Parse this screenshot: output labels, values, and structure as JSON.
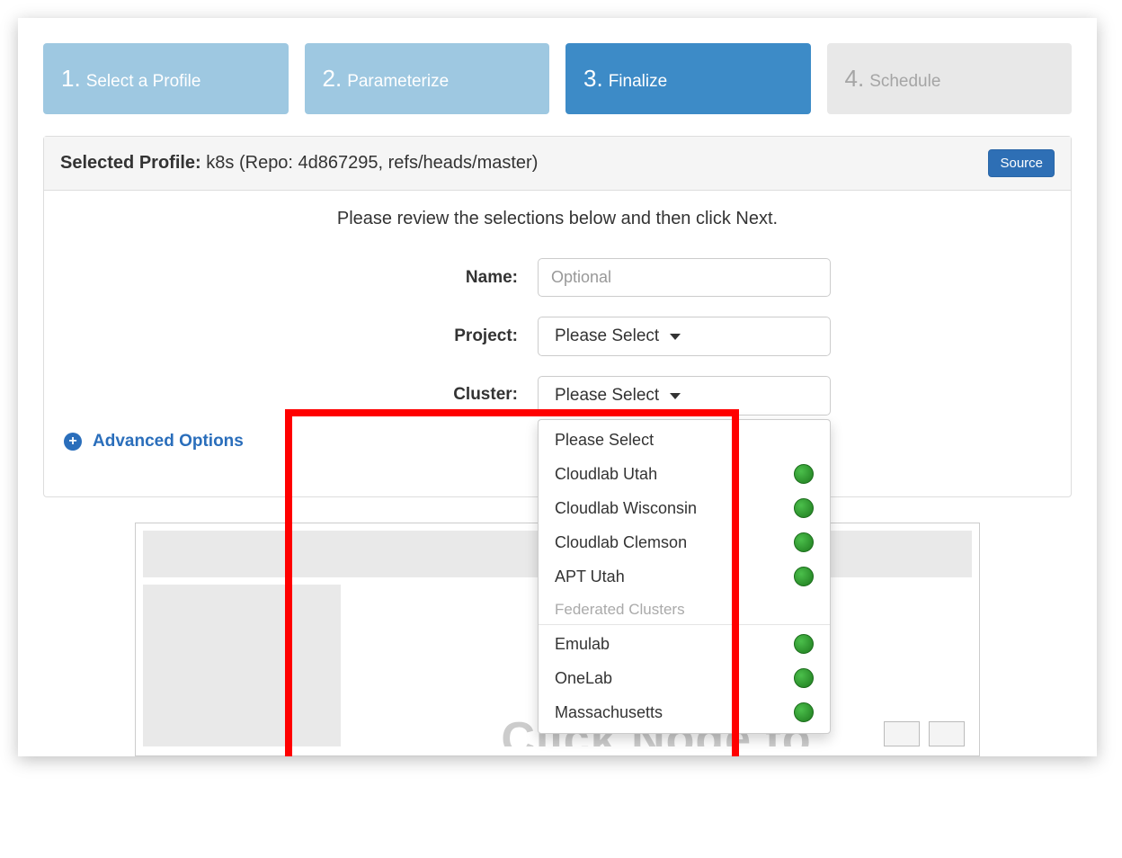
{
  "steps": [
    {
      "num": "1.",
      "label": "Select a Profile"
    },
    {
      "num": "2.",
      "label": "Parameterize"
    },
    {
      "num": "3.",
      "label": "Finalize"
    },
    {
      "num": "4.",
      "label": "Schedule"
    }
  ],
  "panel": {
    "title_label": "Selected Profile:",
    "title_value": "k8s (Repo: 4d867295, refs/heads/master)",
    "source_button": "Source",
    "instruction": "Please review the selections below and then click Next.",
    "name_label": "Name:",
    "name_placeholder": "Optional"
  },
  "project": {
    "label": "Project:",
    "selected": "Please Select"
  },
  "cluster": {
    "label": "Cluster:",
    "selected": "Please Select",
    "items": [
      {
        "label": "Please Select",
        "status": null
      },
      {
        "label": "Cloudlab Utah",
        "status": "up"
      },
      {
        "label": "Cloudlab Wisconsin",
        "status": "up"
      },
      {
        "label": "Cloudlab Clemson",
        "status": "up"
      },
      {
        "label": "APT Utah",
        "status": "up"
      }
    ],
    "federated_header": "Federated Clusters",
    "federated_items": [
      {
        "label": "Emulab",
        "status": "up"
      },
      {
        "label": "OneLab",
        "status": "up"
      },
      {
        "label": "Massachusetts",
        "status": "up"
      }
    ]
  },
  "advanced_label": "Advanced Options",
  "ghost_text": "Click Node to"
}
